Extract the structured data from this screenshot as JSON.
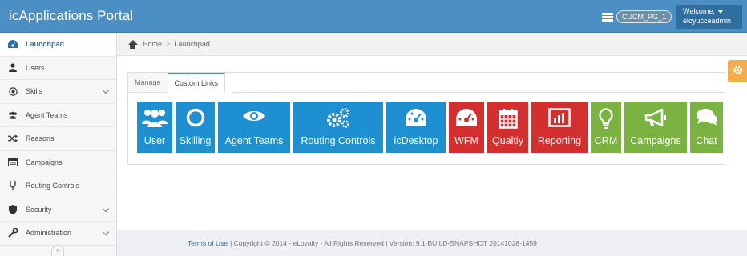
{
  "header": {
    "title": "icApplications Portal",
    "site_badge": "CUCM_PG_1",
    "welcome_line1": "Welcome,",
    "welcome_user": "eloyucceadmin"
  },
  "sidebar": {
    "items": [
      {
        "label": "Launchpad",
        "icon": "dashboard-icon",
        "active": true
      },
      {
        "label": "Users",
        "icon": "user-icon"
      },
      {
        "label": "Skills",
        "icon": "target-icon",
        "expandable": true
      },
      {
        "label": "Agent Teams",
        "icon": "group-icon"
      },
      {
        "label": "Reasons",
        "icon": "shuffle-icon"
      },
      {
        "label": "Campaigns",
        "icon": "list-icon"
      },
      {
        "label": "Routing Controls",
        "icon": "fork-icon"
      },
      {
        "label": "Security",
        "icon": "shield-icon",
        "expandable": true
      },
      {
        "label": "Administration",
        "icon": "wrench-icon",
        "expandable": true
      }
    ]
  },
  "breadcrumb": {
    "home": "Home",
    "current": "Launchpad"
  },
  "tabs": [
    {
      "label": "Manage",
      "active": false
    },
    {
      "label": "Custom Links",
      "active": true
    }
  ],
  "links": [
    {
      "label": "User",
      "color": "#1e8fd0",
      "icon": "users-icon"
    },
    {
      "label": "Skilling",
      "color": "#1e8fd0",
      "icon": "circle-icon"
    },
    {
      "label": "Agent Teams",
      "color": "#1e8fd0",
      "icon": "eye-icon"
    },
    {
      "label": "Routing Controls",
      "color": "#1e8fd0",
      "icon": "cogs-icon"
    },
    {
      "label": "icDesktop",
      "color": "#1e8fd0",
      "icon": "dashboard-icon"
    },
    {
      "label": "WFM",
      "color": "#d32f2f",
      "icon": "gauge-icon"
    },
    {
      "label": "Qualtiy",
      "color": "#d32f2f",
      "icon": "calendar-icon"
    },
    {
      "label": "Reporting",
      "color": "#d32f2f",
      "icon": "bar-chart-icon"
    },
    {
      "label": "CRM",
      "color": "#7bb342",
      "icon": "lightbulb-icon"
    },
    {
      "label": "Campaigns",
      "color": "#7bb342",
      "icon": "megaphone-icon"
    },
    {
      "label": "Chat",
      "color": "#7bb342",
      "icon": "chat-icon"
    }
  ],
  "footer": {
    "terms": "Terms of Use",
    "text": "| Copyright © 2014 - eLoyalty - All Rights Reserved | Version: 9.1-BUILD-SNAPSHOT 20141028-1459"
  },
  "colors": {
    "header": "#4b8fc4",
    "accent_dark": "#2f6f9f",
    "settings": "#f3ad4a"
  }
}
